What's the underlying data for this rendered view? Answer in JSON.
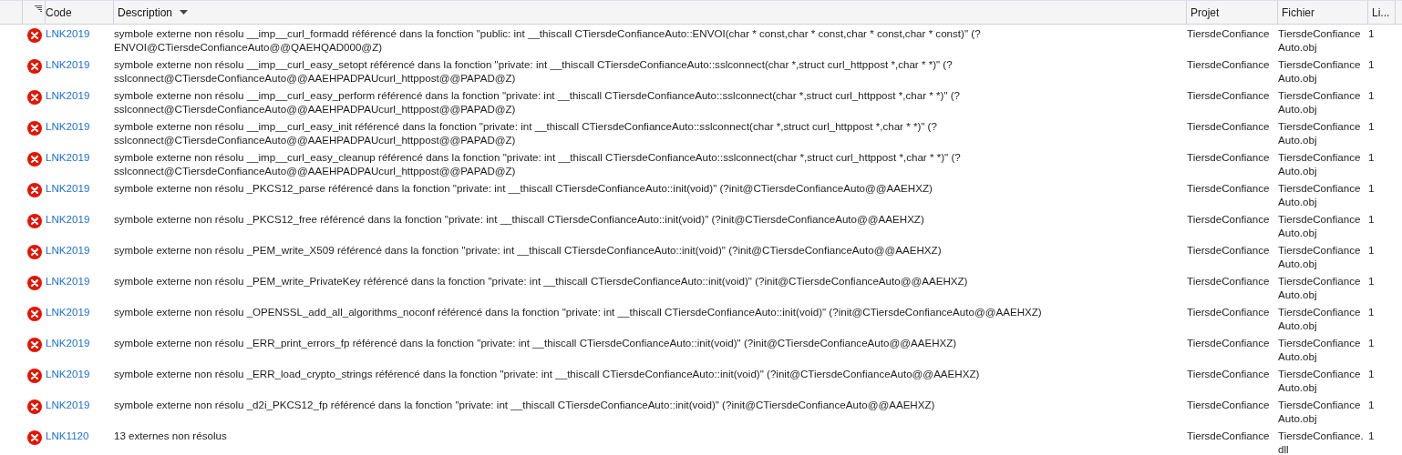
{
  "columns": [
    {
      "label": "Code",
      "sorted": false
    },
    {
      "label": "Description",
      "sorted": true
    },
    {
      "label": "Projet",
      "sorted": false
    },
    {
      "label": "Fichier",
      "sorted": false
    },
    {
      "label": "Li...",
      "sorted": false
    }
  ],
  "rows": [
    {
      "kind": "error",
      "code": "LNK2019",
      "description": "symbole externe non résolu __imp__curl_formadd référencé dans la fonction \"public: int __thiscall CTiersdeConfianceAuto::ENVOI(char * const,char * const,char * const,char * const)\" (?ENVOI@CTiersdeConfianceAuto@@QAEHQAD000@Z)",
      "project": "TiersdeConfiance",
      "file": "TiersdeConfianceAuto.obj",
      "line": "1"
    },
    {
      "kind": "error",
      "code": "LNK2019",
      "description": "symbole externe non résolu __imp__curl_easy_setopt référencé dans la fonction \"private: int __thiscall CTiersdeConfianceAuto::sslconnect(char *,struct curl_httppost *,char * *)\" (?sslconnect@CTiersdeConfianceAuto@@AAEHPADPAUcurl_httppost@@PAPAD@Z)",
      "project": "TiersdeConfiance",
      "file": "TiersdeConfianceAuto.obj",
      "line": "1"
    },
    {
      "kind": "error",
      "code": "LNK2019",
      "description": "symbole externe non résolu __imp__curl_easy_perform référencé dans la fonction \"private: int __thiscall CTiersdeConfianceAuto::sslconnect(char *,struct curl_httppost *,char * *)\" (?sslconnect@CTiersdeConfianceAuto@@AAEHPADPAUcurl_httppost@@PAPAD@Z)",
      "project": "TiersdeConfiance",
      "file": "TiersdeConfianceAuto.obj",
      "line": "1"
    },
    {
      "kind": "error",
      "code": "LNK2019",
      "description": "symbole externe non résolu __imp__curl_easy_init référencé dans la fonction \"private: int __thiscall CTiersdeConfianceAuto::sslconnect(char *,struct curl_httppost *,char * *)\" (?sslconnect@CTiersdeConfianceAuto@@AAEHPADPAUcurl_httppost@@PAPAD@Z)",
      "project": "TiersdeConfiance",
      "file": "TiersdeConfianceAuto.obj",
      "line": "1"
    },
    {
      "kind": "error",
      "code": "LNK2019",
      "description": "symbole externe non résolu __imp__curl_easy_cleanup référencé dans la fonction \"private: int __thiscall CTiersdeConfianceAuto::sslconnect(char *,struct curl_httppost *,char * *)\" (?sslconnect@CTiersdeConfianceAuto@@AAEHPADPAUcurl_httppost@@PAPAD@Z)",
      "project": "TiersdeConfiance",
      "file": "TiersdeConfianceAuto.obj",
      "line": "1"
    },
    {
      "kind": "error",
      "code": "LNK2019",
      "description": "symbole externe non résolu _PKCS12_parse référencé dans la fonction \"private: int __thiscall CTiersdeConfianceAuto::init(void)\" (?init@CTiersdeConfianceAuto@@AAEHXZ)",
      "project": "TiersdeConfiance",
      "file": "TiersdeConfianceAuto.obj",
      "line": "1"
    },
    {
      "kind": "error",
      "code": "LNK2019",
      "description": "symbole externe non résolu _PKCS12_free référencé dans la fonction \"private: int __thiscall CTiersdeConfianceAuto::init(void)\" (?init@CTiersdeConfianceAuto@@AAEHXZ)",
      "project": "TiersdeConfiance",
      "file": "TiersdeConfianceAuto.obj",
      "line": "1"
    },
    {
      "kind": "error",
      "code": "LNK2019",
      "description": "symbole externe non résolu _PEM_write_X509 référencé dans la fonction \"private: int __thiscall CTiersdeConfianceAuto::init(void)\" (?init@CTiersdeConfianceAuto@@AAEHXZ)",
      "project": "TiersdeConfiance",
      "file": "TiersdeConfianceAuto.obj",
      "line": "1"
    },
    {
      "kind": "error",
      "code": "LNK2019",
      "description": "symbole externe non résolu _PEM_write_PrivateKey référencé dans la fonction \"private: int __thiscall CTiersdeConfianceAuto::init(void)\" (?init@CTiersdeConfianceAuto@@AAEHXZ)",
      "project": "TiersdeConfiance",
      "file": "TiersdeConfianceAuto.obj",
      "line": "1"
    },
    {
      "kind": "error",
      "code": "LNK2019",
      "description": "symbole externe non résolu _OPENSSL_add_all_algorithms_noconf référencé dans la fonction \"private: int __thiscall CTiersdeConfianceAuto::init(void)\" (?init@CTiersdeConfianceAuto@@AAEHXZ)",
      "project": "TiersdeConfiance",
      "file": "TiersdeConfianceAuto.obj",
      "line": "1"
    },
    {
      "kind": "error",
      "code": "LNK2019",
      "description": "symbole externe non résolu _ERR_print_errors_fp référencé dans la fonction \"private: int __thiscall CTiersdeConfianceAuto::init(void)\" (?init@CTiersdeConfianceAuto@@AAEHXZ)",
      "project": "TiersdeConfiance",
      "file": "TiersdeConfianceAuto.obj",
      "line": "1"
    },
    {
      "kind": "error",
      "code": "LNK2019",
      "description": "symbole externe non résolu _ERR_load_crypto_strings référencé dans la fonction \"private: int __thiscall CTiersdeConfianceAuto::init(void)\" (?init@CTiersdeConfianceAuto@@AAEHXZ)",
      "project": "TiersdeConfiance",
      "file": "TiersdeConfianceAuto.obj",
      "line": "1"
    },
    {
      "kind": "error",
      "code": "LNK2019",
      "description": "symbole externe non résolu _d2i_PKCS12_fp référencé dans la fonction \"private: int __thiscall CTiersdeConfianceAuto::init(void)\" (?init@CTiersdeConfianceAuto@@AAEHXZ)",
      "project": "TiersdeConfiance",
      "file": "TiersdeConfianceAuto.obj",
      "line": "1"
    },
    {
      "kind": "error",
      "code": "LNK1120",
      "description": "13 externes non résolus",
      "project": "TiersdeConfiance",
      "file": "TiersdeConfiance.dll",
      "line": "1"
    }
  ]
}
